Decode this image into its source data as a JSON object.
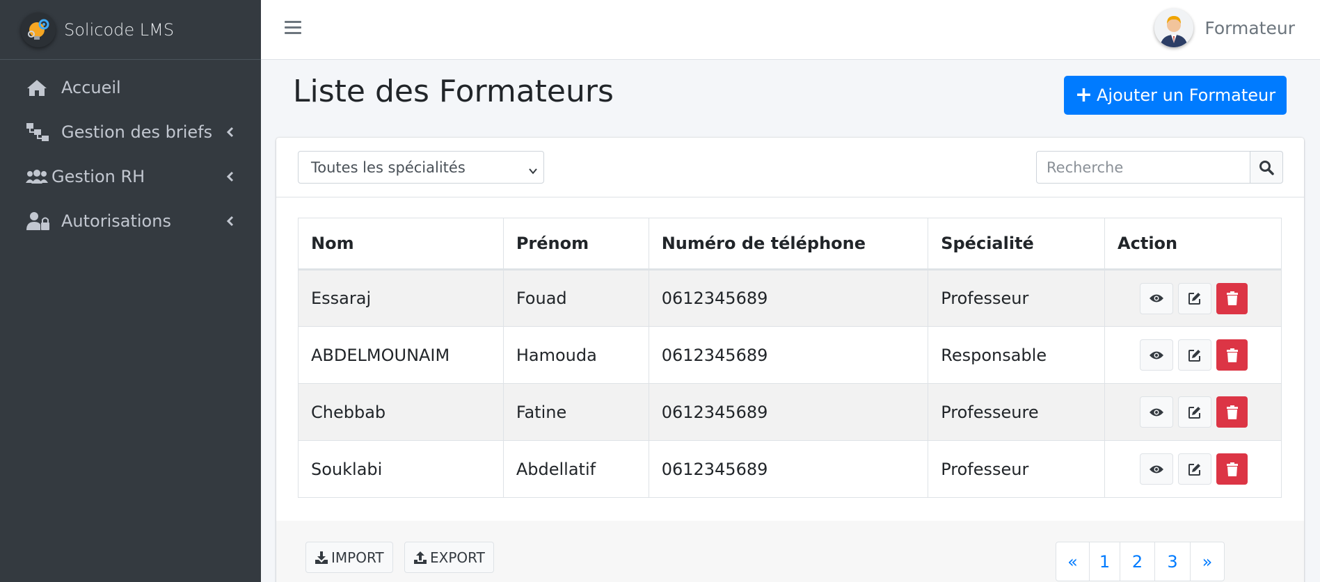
{
  "brand": {
    "name": "Solicode LMS"
  },
  "sidebar": {
    "items": [
      {
        "label": "Accueil",
        "icon": "home-icon",
        "has_submenu": false
      },
      {
        "label": "Gestion des briefs",
        "icon": "sitemap-icon",
        "has_submenu": true
      },
      {
        "label": "Gestion RH",
        "icon": "users-icon",
        "has_submenu": true
      },
      {
        "label": "Autorisations",
        "icon": "user-lock-icon",
        "has_submenu": true
      }
    ]
  },
  "topbar": {
    "user_name": "Formateur"
  },
  "page": {
    "title": "Liste des Formateurs",
    "add_button": "Ajouter un Formateur"
  },
  "filters": {
    "specialty_selected": "Toutes les spécialités",
    "search_placeholder": "Recherche"
  },
  "table": {
    "headers": [
      "Nom",
      "Prénom",
      "Numéro de téléphone",
      "Spécialité",
      "Action"
    ],
    "rows": [
      [
        "Essaraj",
        "Fouad",
        "0612345689",
        "Professeur"
      ],
      [
        "ABDELMOUNAIM",
        "Hamouda",
        "0612345689",
        "Responsable"
      ],
      [
        "Chebbab",
        "Fatine",
        "0612345689",
        "Professeure"
      ],
      [
        "Souklabi",
        "Abdellatif",
        "0612345689",
        "Professeur"
      ]
    ]
  },
  "footer": {
    "import_label": "IMPORT",
    "export_label": "EXPORT",
    "pagination": [
      "«",
      "1",
      "2",
      "3",
      "»"
    ]
  },
  "colors": {
    "sidebar_bg": "#343a40",
    "primary": "#007bff",
    "danger": "#dc3545",
    "content_bg": "#f4f6f9"
  }
}
